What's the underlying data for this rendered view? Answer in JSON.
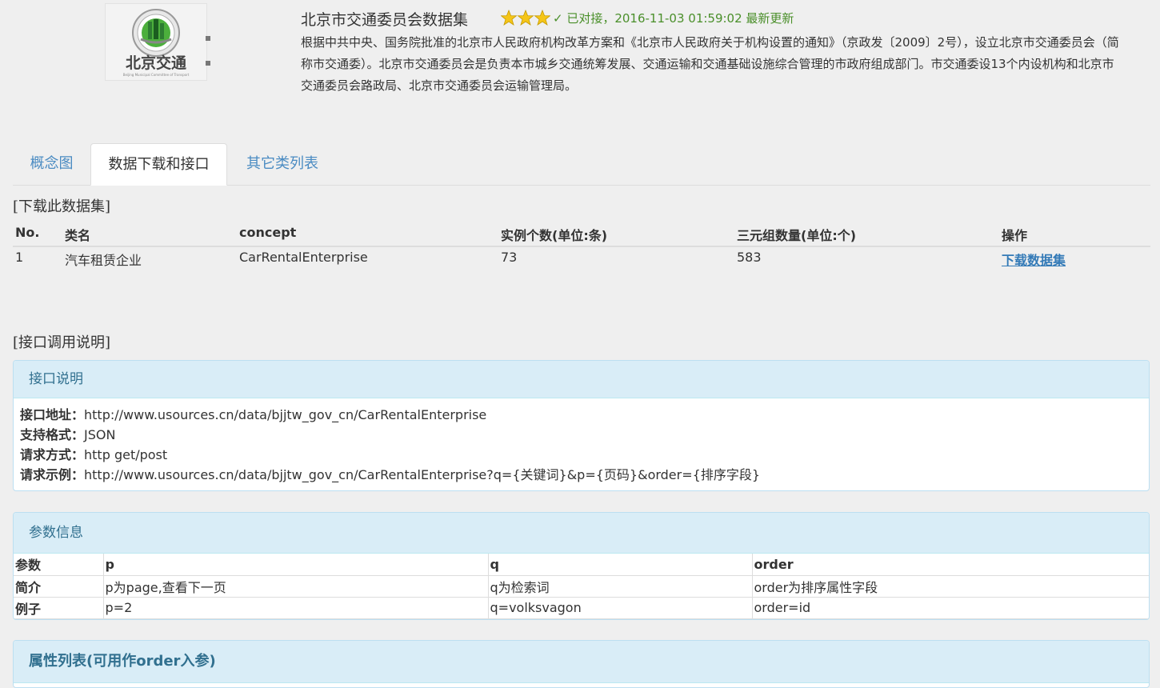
{
  "header": {
    "logo_text": "北京交通",
    "logo_subtext": "Beijing Municipal Committee of Transport",
    "title": "北京市交通委员会数据集",
    "rating_stars": 3,
    "status": "✓ 已对接，2016-11-03 01:59:02 最新更新",
    "description": "根据中共中央、国务院批准的北京市人民政府机构改革方案和《北京市人民政府关于机构设置的通知》（京政发〔2009〕2号），设立北京市交通委员会（简称市交通委）。北京市交通委员会是负责本市城乡交通统筹发展、交通运输和交通基础设施综合管理的市政府组成部门。市交通委设13个内设机构和北京市交通委员会路政局、北京市交通委员会运输管理局。"
  },
  "tabs": [
    {
      "label": "概念图",
      "active": false
    },
    {
      "label": "数据下载和接口",
      "active": true
    },
    {
      "label": "其它类列表",
      "active": false
    }
  ],
  "download": {
    "heading": "[下载此数据集]",
    "columns": [
      "No.",
      "类名",
      "concept",
      "实例个数(单位:条)",
      "三元组数量(单位:个)",
      "操作"
    ],
    "rows": [
      {
        "no": "1",
        "class_name": "汽车租赁企业",
        "concept": "CarRentalEnterprise",
        "instances": "73",
        "triples": "583",
        "action": "下载数据集"
      }
    ]
  },
  "api": {
    "heading": "[接口调用说明]",
    "panel_title": "接口说明",
    "lines": [
      {
        "label": "接口地址：",
        "value": "http://www.usources.cn/data/bjjtw_gov_cn/CarRentalEnterprise"
      },
      {
        "label": "支持格式：",
        "value": "JSON"
      },
      {
        "label": "请求方式：",
        "value": "http get/post"
      },
      {
        "label": "请求示例：",
        "value": "http://www.usources.cn/data/bjjtw_gov_cn/CarRentalEnterprise?q={关键词}&p={页码}&order={排序字段}"
      }
    ]
  },
  "params": {
    "panel_title": "参数信息",
    "rows": [
      [
        "参数",
        "p",
        "q",
        "order"
      ],
      [
        "简介",
        "p为page,查看下一页",
        "q为检索词",
        "order为排序属性字段"
      ],
      [
        "例子",
        "p=2",
        "q=volksvagon",
        "order=id"
      ]
    ]
  },
  "attributes": {
    "panel_title": "属性列表(可用作order入参)"
  },
  "colors": {
    "accent": "#337ab7",
    "panel_heading_bg": "#d9edf7",
    "panel_heading_text": "#31708f",
    "status_green": "#4a8f2a",
    "star_gold": "#f5c518"
  }
}
